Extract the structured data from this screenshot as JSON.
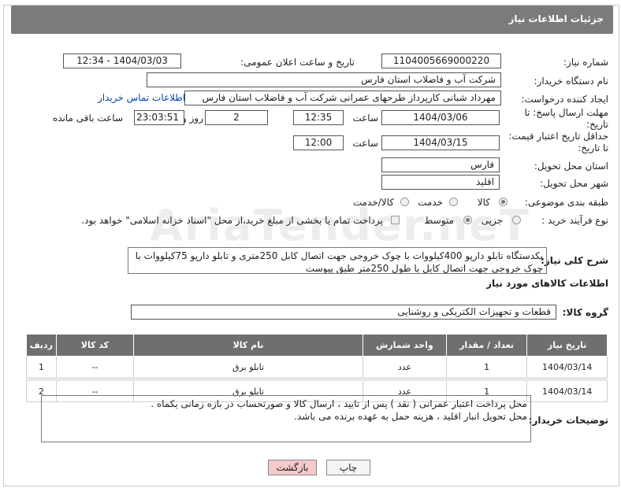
{
  "header": {
    "title": "جزئیات اطلاعات نیاز"
  },
  "fields": {
    "need_number_label": "شماره نیاز:",
    "need_number": "1104005669000220",
    "announce_label": "تاریخ و ساعت اعلان عمومی:",
    "announce_value": "1404/03/03 - 12:34",
    "buyer_org_label": "نام دستگاه خریدار:",
    "buyer_org": "شرکت آب و فاضلاب استان فارس",
    "creator_label": "ایجاد کننده درخواست:",
    "creator": "مهرداد شبانی کارپرداز طرحهای عمرانی  شرکت آب و فاضلاب استان فارس",
    "contact_link": "اطلاعات تماس خریدار",
    "deadline_label": "مهلت ارسال پاسخ: تا تاریخ:",
    "deadline_date": "1404/03/06",
    "time_label": "ساعت",
    "deadline_time": "12:35",
    "days_value": "2",
    "days_label": "روز و",
    "remaining_time": "23:03:51",
    "remaining_label": "ساعت باقی مانده",
    "validity_label": "حداقل تاریخ اعتبار قیمت: تا تاریخ:",
    "validity_date": "1404/03/15",
    "validity_time": "12:00",
    "province_label": "استان محل تحویل:",
    "province": "فارس",
    "city_label": "شهر محل تحویل:",
    "city": "اقلید",
    "category_label": "طبقه بندی موضوعی:",
    "category_opt1": "کالا",
    "category_opt2": "خدمت",
    "category_opt3": "کالا/خدمت",
    "process_label": "نوع فرآیند خرید :",
    "process_opt1": "جزیی",
    "process_opt2": "متوسط",
    "payment_note": "پرداخت تمام یا بخشی از مبلغ خرید،از محل \"اسناد خزانه اسلامی\" خواهد بود.",
    "general_desc_label": "شرح کلی نیاز:",
    "general_desc": "یکدستگاه تابلو دارپو 400کیلووات با چوک خروجی جهت اتصال کابل 250متری و تابلو دارپو 75کیلووات با چوک خروجی جهت اتصال کابل با طول 250متر طبق پیوست"
  },
  "goods": {
    "section_title": "اطلاعات کالاهای مورد نیاز",
    "group_label": "گروه کالا:",
    "group_value": "قطعات و تجهیزات الکتریکی و روشنایی",
    "columns": [
      "ردیف",
      "کد کالا",
      "نام کالا",
      "واحد شمارش",
      "تعداد / مقدار",
      "تاریخ نیاز"
    ],
    "rows": [
      {
        "idx": "1",
        "code": "--",
        "name": "تابلو برق",
        "unit": "عدد",
        "qty": "1",
        "date": "1404/03/14"
      },
      {
        "idx": "2",
        "code": "--",
        "name": "تابلو برق",
        "unit": "عدد",
        "qty": "1",
        "date": "1404/03/14"
      }
    ]
  },
  "buyer_notes": {
    "label": "توضیحات خریدار:",
    "line1": "محل پرداخت اعتبار عمرانی ( نقد ) پس از تایید ، ارسال کالا و صورتحساب در بازه زمانی یکماه .",
    "line2": "محل تحویل انبار اقلید  ، هزینه حمل به عهده برنده می باشد."
  },
  "buttons": {
    "print": "چاپ",
    "back": "بازگشت"
  },
  "colors": {
    "header_bg": "#7b7b7b",
    "table_header_bg": "#6f6f6f",
    "back_btn_bg": "#f5c9c9",
    "link": "#0645ad"
  }
}
